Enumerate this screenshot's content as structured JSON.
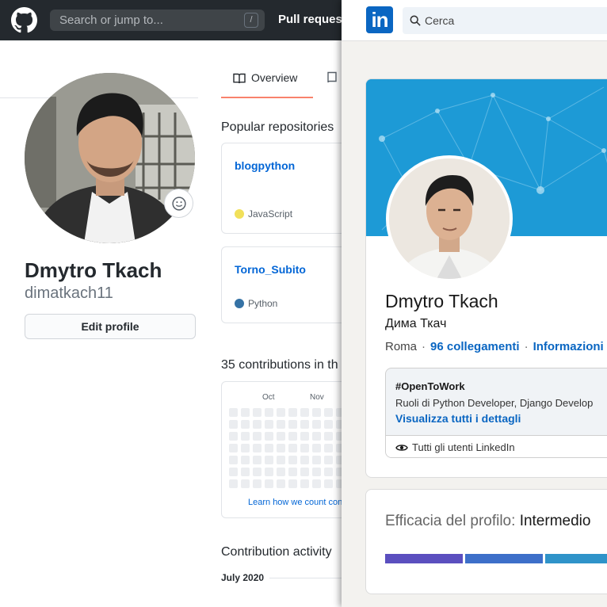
{
  "github": {
    "search_placeholder": "Search or jump to...",
    "search_shortcut": "/",
    "nav_pull_requests": "Pull requests",
    "profile": {
      "name": "Dmytro Tkach",
      "login": "dimatkach11",
      "edit_button": "Edit profile"
    },
    "tabs": {
      "overview": "Overview"
    },
    "popular_title": "Popular repositories",
    "repos": [
      {
        "name": "blogpython",
        "language": "JavaScript",
        "color": "#f1e05a"
      },
      {
        "name": "Torno_Subito",
        "language": "Python",
        "color": "#3572a5"
      }
    ],
    "contributions_title": "35 contributions in th",
    "calendar_months": [
      "Oct",
      "Nov"
    ],
    "calendar_link": "Learn how we count con",
    "activity_title": "Contribution activity",
    "activity_month": "July 2020"
  },
  "linkedin": {
    "logo_text": "in",
    "search_placeholder": "Cerca",
    "profile": {
      "name": "Dmytro Tkach",
      "alt_name": "Дима Ткач",
      "location": "Roma",
      "connections": "96 collegamenti",
      "contact_info": "Informazioni"
    },
    "open_to_work": {
      "title": "#OpenToWork",
      "roles": "Ruoli di Python Developer, Django Develop",
      "details_link": "Visualizza tutti i dettagli",
      "visibility": "Tutti gli utenti LinkedIn"
    },
    "strength": {
      "label": "Efficacia del profilo:",
      "level": "Intermedio"
    }
  },
  "colors": {
    "github_header": "#24292e",
    "github_link": "#0366d6",
    "tab_underline": "#f9826c",
    "linkedin_blue": "#0a66c2",
    "banner": "#1d9ad6"
  }
}
